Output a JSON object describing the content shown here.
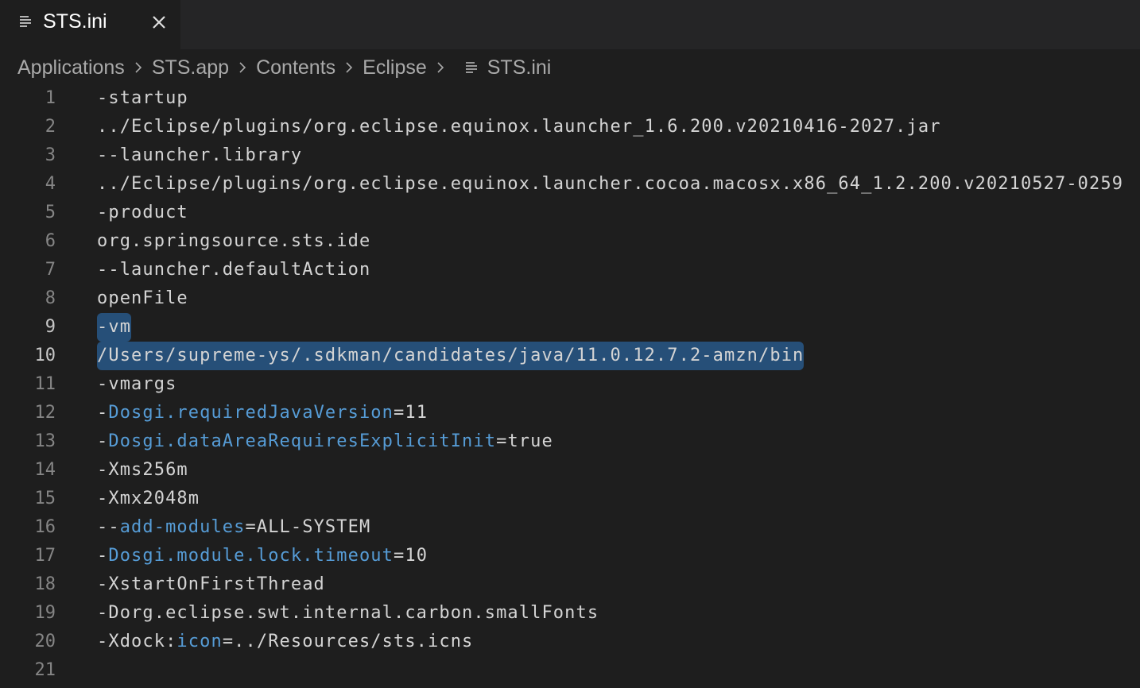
{
  "tab": {
    "label": "STS.ini",
    "icon": "file-lines-icon",
    "close_icon": "close-icon"
  },
  "breadcrumb": {
    "items": [
      "Applications",
      "STS.app",
      "Contents",
      "Eclipse"
    ],
    "file": "STS.ini"
  },
  "colors": {
    "background": "#1e1e1e",
    "tabbar": "#252526",
    "text": "#d4d4d4",
    "key": "#569cd6",
    "line_number": "#858585",
    "selection": "#264f78"
  },
  "editor": {
    "selected_lines": [
      9,
      10
    ],
    "lines": [
      {
        "n": "1",
        "parts": [
          {
            "t": "-startup",
            "k": false
          }
        ]
      },
      {
        "n": "2",
        "parts": [
          {
            "t": "../Eclipse/plugins/org.eclipse.equinox.launcher_1.6.200.v20210416-2027.jar",
            "k": false
          }
        ]
      },
      {
        "n": "3",
        "parts": [
          {
            "t": "--launcher.library",
            "k": false
          }
        ]
      },
      {
        "n": "4",
        "parts": [
          {
            "t": "../Eclipse/plugins/org.eclipse.equinox.launcher.cocoa.macosx.x86_64_1.2.200.v20210527-0259",
            "k": false
          }
        ]
      },
      {
        "n": "5",
        "parts": [
          {
            "t": "-product",
            "k": false
          }
        ]
      },
      {
        "n": "6",
        "parts": [
          {
            "t": "org.springsource.sts.ide",
            "k": false
          }
        ]
      },
      {
        "n": "7",
        "parts": [
          {
            "t": "--launcher.defaultAction",
            "k": false
          }
        ]
      },
      {
        "n": "8",
        "parts": [
          {
            "t": "openFile",
            "k": false
          }
        ]
      },
      {
        "n": "9",
        "parts": [
          {
            "t": "-vm",
            "k": false
          }
        ]
      },
      {
        "n": "10",
        "parts": [
          {
            "t": "/Users/supreme-ys/.sdkman/candidates/java/11.0.12.7.2-amzn/bin",
            "k": false
          }
        ]
      },
      {
        "n": "11",
        "parts": [
          {
            "t": "-vmargs",
            "k": false
          }
        ]
      },
      {
        "n": "12",
        "parts": [
          {
            "t": "-",
            "k": false
          },
          {
            "t": "Dosgi.requiredJavaVersion",
            "k": true
          },
          {
            "t": "=11",
            "k": false
          }
        ]
      },
      {
        "n": "13",
        "parts": [
          {
            "t": "-",
            "k": false
          },
          {
            "t": "Dosgi.dataAreaRequiresExplicitInit",
            "k": true
          },
          {
            "t": "=true",
            "k": false
          }
        ]
      },
      {
        "n": "14",
        "parts": [
          {
            "t": "-Xms256m",
            "k": false
          }
        ]
      },
      {
        "n": "15",
        "parts": [
          {
            "t": "-Xmx2048m",
            "k": false
          }
        ]
      },
      {
        "n": "16",
        "parts": [
          {
            "t": "--",
            "k": false
          },
          {
            "t": "add-modules",
            "k": true
          },
          {
            "t": "=ALL-SYSTEM",
            "k": false
          }
        ]
      },
      {
        "n": "17",
        "parts": [
          {
            "t": "-",
            "k": false
          },
          {
            "t": "Dosgi.module.lock.timeout",
            "k": true
          },
          {
            "t": "=10",
            "k": false
          }
        ]
      },
      {
        "n": "18",
        "parts": [
          {
            "t": "-XstartOnFirstThread",
            "k": false
          }
        ]
      },
      {
        "n": "19",
        "parts": [
          {
            "t": "-Dorg.eclipse.swt.internal.carbon.smallFonts",
            "k": false
          }
        ]
      },
      {
        "n": "20",
        "parts": [
          {
            "t": "-Xdock:",
            "k": false
          },
          {
            "t": "icon",
            "k": true
          },
          {
            "t": "=../Resources/sts.icns",
            "k": false
          }
        ]
      },
      {
        "n": "21",
        "parts": []
      }
    ]
  }
}
